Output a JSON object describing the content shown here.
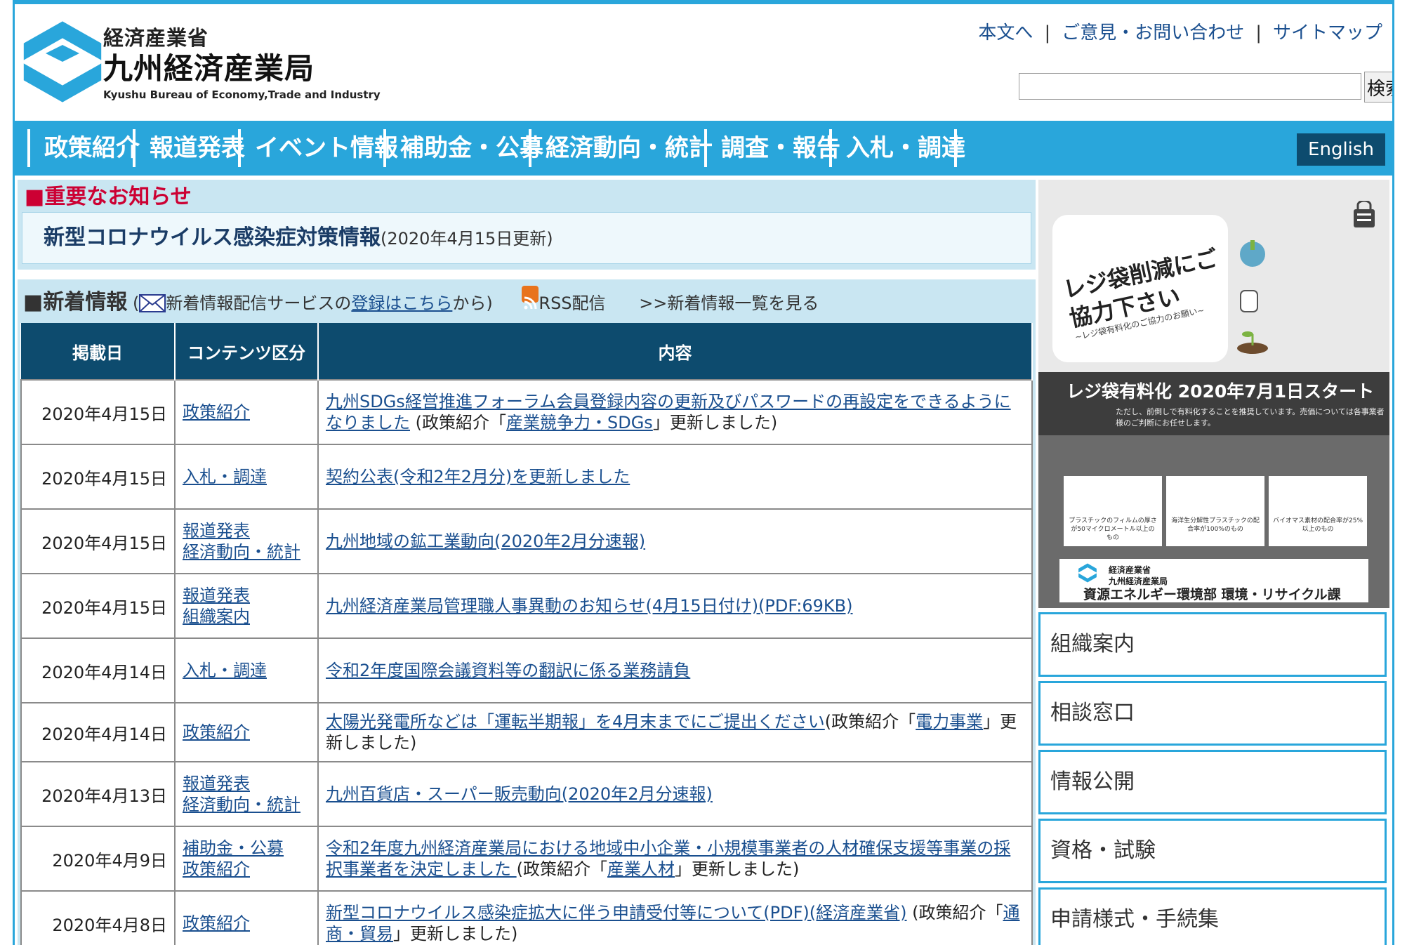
{
  "header": {
    "ministry": "経済産業省",
    "bureau": "九州経済産業局",
    "bureau_en": "Kyushu Bureau of Economy,Trade and Industry",
    "top_links": [
      "本文へ",
      "ご意見・お問い合わせ",
      "サイトマップ"
    ],
    "separator": "|",
    "search_button": "検索",
    "search_value": ""
  },
  "nav": {
    "items": [
      "政策紹介",
      "報道発表",
      "イベント情報",
      "補助金・公募",
      "経済動向・統計",
      "調査・報告",
      "入札・調達"
    ],
    "english": "English"
  },
  "notice": {
    "heading": "■重要なお知らせ",
    "link": "新型コロナウイルス感染症対策情報",
    "date": "(2020年4月15日更新)"
  },
  "news": {
    "heading": "■新着情報",
    "subscribe_pre": "(",
    "subscribe_text": "新着情報配信サービスの",
    "subscribe_link": "登録はこちら",
    "subscribe_post": "から)",
    "rss": "RSS配信",
    "list_link": ">>新着情報一覧を見る",
    "columns": [
      "掲載日",
      "コンテンツ区分",
      "内容"
    ],
    "rows": [
      {
        "date": "2020年4月15日",
        "cats": [
          "政策紹介"
        ],
        "link": "九州SDGs経営推進フォーラム会員登録内容の更新及びパスワードの再設定をできるようになりました",
        "pre": " (政策紹介「",
        "sub": "産業競争力・SDGs",
        "post": "」更新しました)"
      },
      {
        "date": "2020年4月15日",
        "cats": [
          "入札・調達"
        ],
        "link": "契約公表(令和2年2月分)を更新しました",
        "pre": "",
        "sub": "",
        "post": ""
      },
      {
        "date": "2020年4月15日",
        "cats": [
          "報道発表",
          "経済動向・統計"
        ],
        "link": "九州地域の鉱工業動向(2020年2月分速報) ",
        "pre": "",
        "sub": "",
        "post": ""
      },
      {
        "date": "2020年4月15日",
        "cats": [
          "報道発表",
          "組織案内"
        ],
        "link": "九州経済産業局管理職人事異動のお知らせ(4月15日付け)(PDF:69KB)",
        "pre": "",
        "sub": "",
        "post": ""
      },
      {
        "date": "2020年4月14日",
        "cats": [
          "入札・調達"
        ],
        "link": "令和2年度国際会議資料等の翻訳に係る業務請負",
        "pre": "",
        "sub": "",
        "post": ""
      },
      {
        "date": "2020年4月14日",
        "cats": [
          "政策紹介"
        ],
        "link": "太陽光発電所などは「運転半期報」を4月末までにご提出ください",
        "pre": "(政策紹介「",
        "sub": "電力事業",
        "post": "」更新しました)"
      },
      {
        "date": "2020年4月13日",
        "cats": [
          "報道発表",
          "経済動向・統計"
        ],
        "link": "九州百貨店・スーパー販売動向(2020年2月分速報) ",
        "pre": "",
        "sub": "",
        "post": ""
      },
      {
        "date": "2020年4月9日",
        "cats": [
          "補助金・公募",
          "政策紹介"
        ],
        "link": "令和2年度九州経済産業局における地域中小企業・小規模事業者の人材確保支援等事業の採択事業者を決定しました ",
        "pre": "(政策紹介「",
        "sub": "産業人材",
        "post": "」更新しました)"
      },
      {
        "date": "2020年4月8日",
        "cats": [
          "政策紹介"
        ],
        "link": "新型コロナウイルス感染症拡大に伴う申請受付等について(PDF)(経済産業省)",
        "pre": " (政策紹介「",
        "sub": "通商・貿易",
        "post": "」更新しました)"
      }
    ]
  },
  "banner": {
    "title": "レジ袋削減にご協力下さい",
    "subtitle": "~レジ袋有料化のご協力のお願い~",
    "headline": "レジ袋有料化 2020年7月1日スタート",
    "small_text": "ただし、前倒しで有料化することを推奨しています。売価については各事業者様のご判断にお任せします。",
    "bag_labels": [
      "プラスチックのフィルムの厚さが50マイクロメートル以上のもの",
      "海洋生分解性プラスチックの配合率が100%のもの",
      "バイオマス素材の配合率が25%以上のもの"
    ],
    "footer_org_1": "経済産業省",
    "footer_org_2": "九州経済産業局",
    "footer_dept": "資源エネルギー環境部 環境・リサイクル課"
  },
  "sidebar": {
    "items": [
      "組織案内",
      "相談窓口",
      "情報公開",
      "資格・試験",
      "申請様式・手続集"
    ]
  },
  "colors": {
    "accent": "#29a6db",
    "navy": "#0d4b6e",
    "notice_red": "#cc0033",
    "link": "#1a4f8f"
  }
}
